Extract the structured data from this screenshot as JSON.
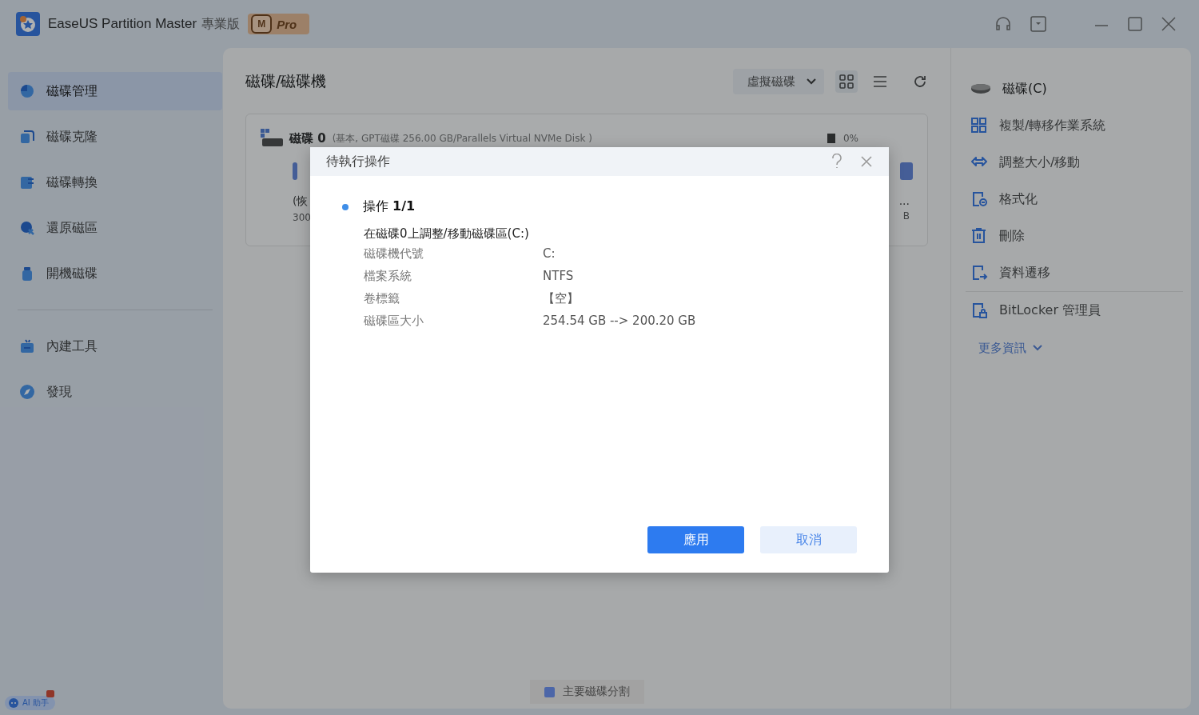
{
  "window": {
    "title": "EaseUS Partition Master",
    "edition": "專業版",
    "badge_letter": "M",
    "badge": "Pro"
  },
  "sidebar": {
    "main_items": [
      {
        "label": "磁碟管理",
        "selected": true
      },
      {
        "label": "磁碟克隆",
        "selected": false
      },
      {
        "label": "磁碟轉換",
        "selected": false
      },
      {
        "label": "還原磁區",
        "selected": false
      },
      {
        "label": "開機磁碟",
        "selected": false
      }
    ],
    "tool_items": [
      {
        "label": "內建工具",
        "selected": false
      },
      {
        "label": "發現",
        "selected": false
      }
    ]
  },
  "main": {
    "title": "磁碟/磁碟機",
    "view_dropdown": "虛擬磁碟",
    "view_buttons": [
      {
        "kind": "grid",
        "selected": true
      },
      {
        "kind": "list",
        "selected": false
      }
    ],
    "disk": {
      "name": "磁碟 0",
      "details": "(基本, GPT磁碟 256.00 GB/Parallels Virtual NVMe Disk )",
      "usage": "0%",
      "left_label": "(恢",
      "left_size": "300",
      "right_label": "...",
      "right_size": "B"
    },
    "legend": [
      {
        "label": "主要磁碟分割",
        "color": "#4c66a8"
      }
    ]
  },
  "right_pane": {
    "disk": "磁碟(C)",
    "actions": [
      {
        "label": "複製/轉移作業系統"
      },
      {
        "label": "調整大小/移動"
      },
      {
        "label": "格式化"
      },
      {
        "label": "刪除"
      },
      {
        "label": "資料遷移"
      }
    ],
    "extra_actions": [
      {
        "label": "BitLocker 管理員"
      }
    ],
    "more": "更多資訊"
  },
  "dialog": {
    "title": "待執行操作",
    "operation": "操作 **1/1**",
    "description": "在磁碟0上調整/移動磁碟區(C:)",
    "details": [
      {
        "label": "磁碟機代號",
        "value": "C:"
      },
      {
        "label": "檔案系統",
        "value": "NTFS"
      },
      {
        "label": "卷標籤",
        "value": "【空】"
      },
      {
        "label": "磁碟區大小",
        "value": "254.54 GB --> 200.20 GB"
      }
    ],
    "apply": "應用",
    "cancel": "取消"
  },
  "ai_assistant": {
    "label": "AI 助手"
  }
}
